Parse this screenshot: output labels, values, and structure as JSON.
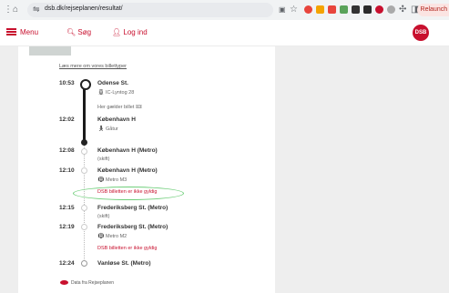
{
  "browser": {
    "url": "dsb.dk/rejseplanen/resultat/",
    "relaunch_label": "Relaunch t"
  },
  "header": {
    "menu_label": "Menu",
    "search_label": "Søg",
    "login_label": "Log ind",
    "logo_text": "DSB"
  },
  "links": {
    "more_about_tickets": "Læs mere om vores billettyper"
  },
  "stops": [
    {
      "time": "10:53",
      "name": "Odense St.",
      "sub": "IC-Lyntog 28",
      "sub_icon": "train-icon",
      "extra": "Her gælder billet"
    },
    {
      "time": "12:02",
      "name": "København H",
      "sub": "Gåtur",
      "sub_icon": "walk-icon"
    },
    {
      "time": "12:08",
      "name": "København H (Metro)",
      "sub": "(skift)"
    },
    {
      "time": "12:10",
      "name": "København H (Metro)",
      "sub": "Metro M3",
      "sub_icon": "metro-icon",
      "warning": "DSB billetten er ikke gyldig"
    },
    {
      "time": "12:15",
      "name": "Frederiksberg St. (Metro)",
      "sub": "(skift)"
    },
    {
      "time": "12:19",
      "name": "Frederiksberg St. (Metro)",
      "sub": "Metro M2",
      "sub_icon": "metro-icon",
      "warning": "DSB billetten er ikke gyldig"
    },
    {
      "time": "12:24",
      "name": "Vanløse St. (Metro)"
    }
  ],
  "footer": {
    "partner_text": "Data fra Rejseplanen"
  },
  "colors": {
    "brand_red": "#c8102e",
    "highlight_green": "#6fce7a"
  }
}
